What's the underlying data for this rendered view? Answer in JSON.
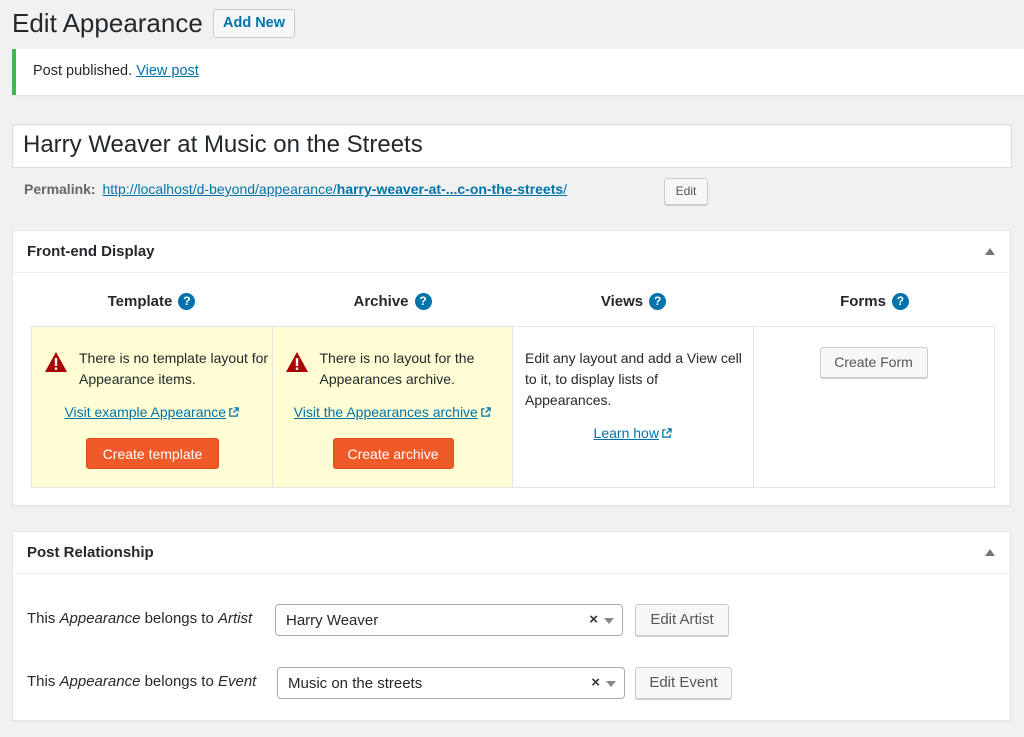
{
  "header": {
    "title": "Edit Appearance",
    "add_new": "Add New"
  },
  "notice": {
    "text": "Post published.",
    "link": "View post"
  },
  "post_title": "Harry Weaver at Music on the Streets",
  "permalink": {
    "label": "Permalink:",
    "url_prefix": "http://localhost/d-beyond/appearance/",
    "url_slug": "harry-weaver-at-...c-on-the-streets",
    "url_suffix": "/",
    "edit": "Edit"
  },
  "front_end_display": {
    "title": "Front-end Display",
    "columns": [
      {
        "heading": "Template",
        "help": "?"
      },
      {
        "heading": "Archive",
        "help": "?"
      },
      {
        "heading": "Views",
        "help": "?"
      },
      {
        "heading": "Forms",
        "help": "?"
      }
    ],
    "template": {
      "warning": "There is no template layout for Appearance items.",
      "link": "Visit example Appearance",
      "button": "Create template"
    },
    "archive": {
      "warning": "There is no layout for the Appearances archive.",
      "link": "Visit the Appearances archive",
      "button": "Create archive"
    },
    "views": {
      "text": "Edit any layout and add a View cell to it, to display lists of Appearances.",
      "link": "Learn how"
    },
    "forms": {
      "button": "Create Form"
    }
  },
  "post_relationship": {
    "title": "Post Relationship",
    "rows": [
      {
        "prefix": "This ",
        "post_type": "Appearance",
        "middle": " belongs to ",
        "parent": "Artist",
        "value": "Harry Weaver",
        "clear": "×",
        "button": "Edit Artist"
      },
      {
        "prefix": "This ",
        "post_type": "Appearance",
        "middle": " belongs to ",
        "parent": "Event",
        "value": "Music on the streets",
        "clear": "×",
        "button": "Edit Event"
      }
    ]
  },
  "colors": {
    "accent": "#0073aa",
    "success": "#46b450",
    "orange": "#f05a28",
    "warning_bg": "#fefdd3",
    "warning_icon": "#a00"
  }
}
